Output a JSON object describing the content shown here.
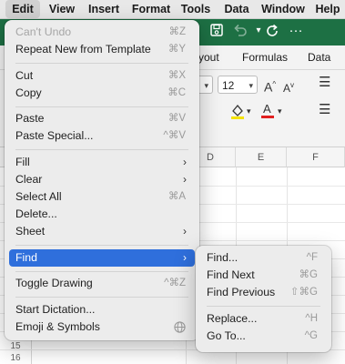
{
  "menubar": {
    "items": [
      "Edit",
      "View",
      "Insert",
      "Format",
      "Tools",
      "Data",
      "Window",
      "Help"
    ],
    "active": "Edit"
  },
  "ribbon": {
    "tabs": [
      "yout",
      "Formulas",
      "Data"
    ]
  },
  "toolbar": {
    "font_size": "12"
  },
  "sheet": {
    "columns": [
      "D",
      "E",
      "F"
    ],
    "row_numbers": [
      "15",
      "16"
    ]
  },
  "edit_menu": {
    "items": [
      {
        "label": "Can't Undo",
        "shortcut": "⌘Z",
        "disabled": true
      },
      {
        "label": "Repeat New from Template",
        "shortcut": "⌘Y"
      },
      {
        "label": "Cut",
        "shortcut": "⌘X"
      },
      {
        "label": "Copy",
        "shortcut": "⌘C"
      },
      {
        "label": "Paste",
        "shortcut": "⌘V"
      },
      {
        "label": "Paste Special...",
        "shortcut": "^⌘V"
      },
      {
        "label": "Fill",
        "submenu": true
      },
      {
        "label": "Clear",
        "submenu": true
      },
      {
        "label": "Select All",
        "shortcut": "⌘A"
      },
      {
        "label": "Delete..."
      },
      {
        "label": "Sheet",
        "submenu": true
      },
      {
        "label": "Find",
        "submenu": true,
        "highlighted": true
      },
      {
        "label": "Toggle Drawing",
        "shortcut": "^⌘Z"
      },
      {
        "label": "Start Dictation..."
      },
      {
        "label": "Emoji & Symbols",
        "shortcut_icon": "globe-icon"
      }
    ]
  },
  "find_submenu": {
    "items": [
      {
        "label": "Find...",
        "shortcut": "^F"
      },
      {
        "label": "Find Next",
        "shortcut": "⌘G"
      },
      {
        "label": "Find Previous",
        "shortcut": "⇧⌘G"
      },
      {
        "label": "Replace...",
        "shortcut": "^H"
      },
      {
        "label": "Go To...",
        "shortcut": "^G"
      }
    ]
  },
  "colors": {
    "excel_green": "#1d7044",
    "menu_highlight": "#2f6fdc",
    "menu_bg": "#ececec",
    "disabled_text": "#a6a6a6"
  }
}
